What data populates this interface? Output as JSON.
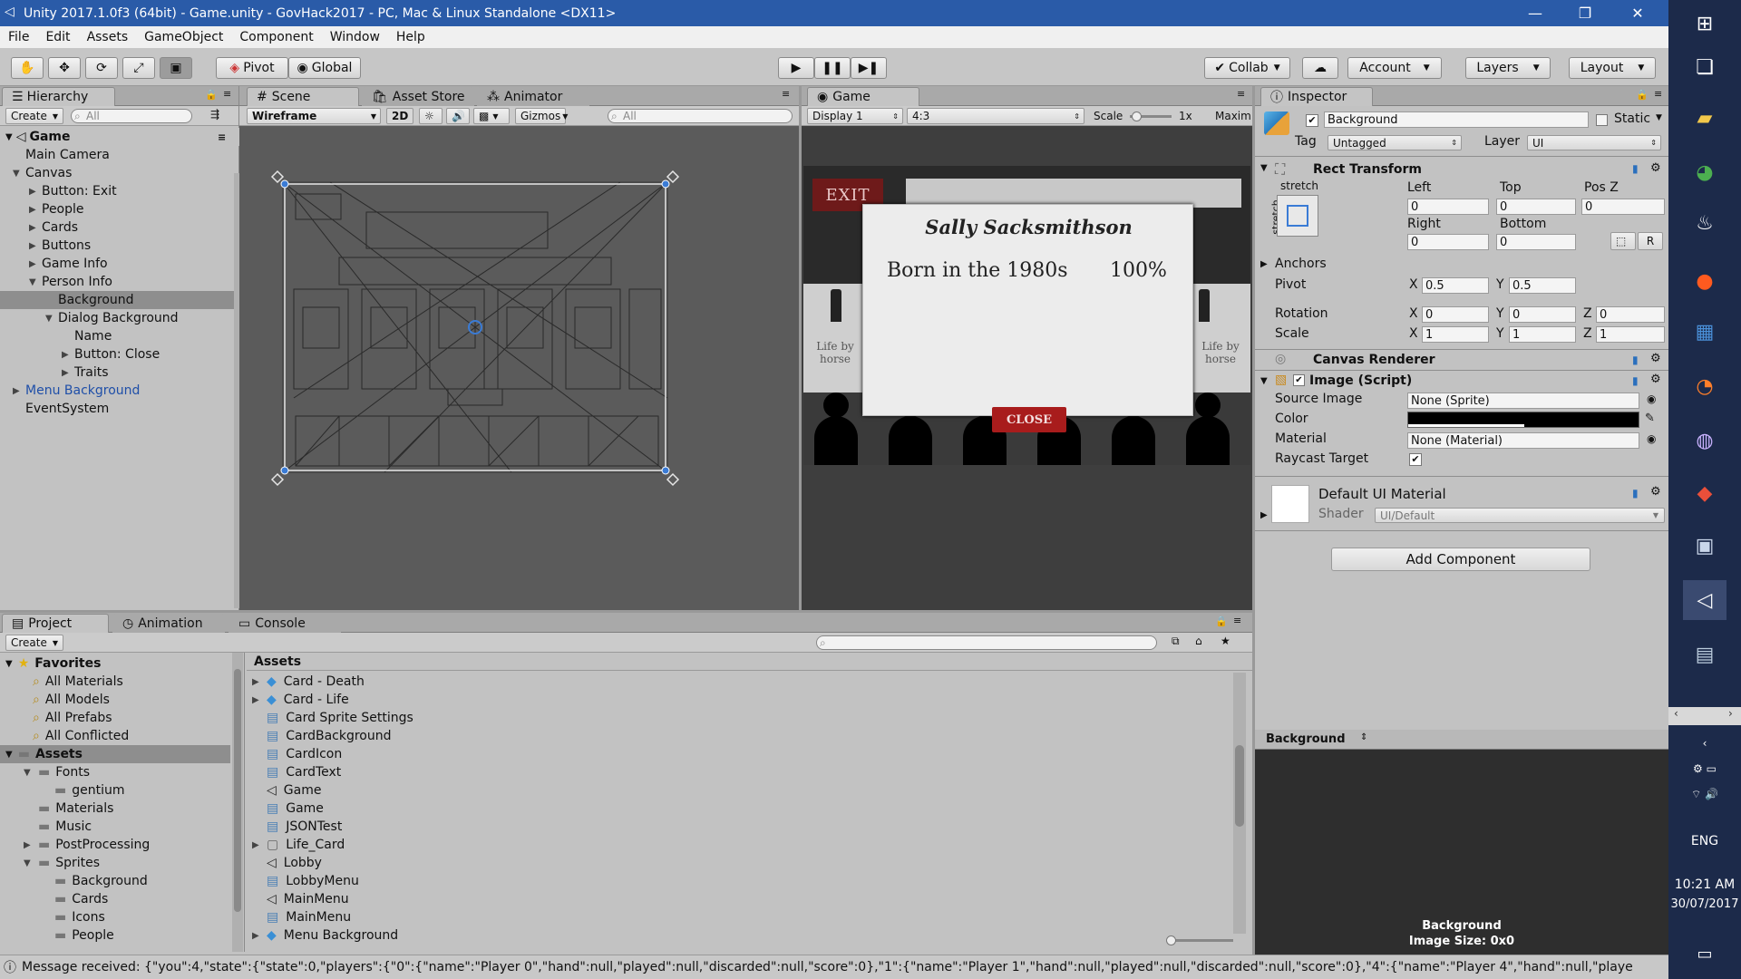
{
  "window": {
    "title": "Unity 2017.1.0f3 (64bit) - Game.unity - GovHack2017 - PC, Mac & Linux Standalone <DX11>"
  },
  "menu": [
    "File",
    "Edit",
    "Assets",
    "GameObject",
    "Component",
    "Window",
    "Help"
  ],
  "toolbar": {
    "pivot": "Pivot",
    "global": "Global",
    "collab": "Collab",
    "account": "Account",
    "layers": "Layers",
    "layout": "Layout"
  },
  "hierarchy": {
    "tab": "Hierarchy",
    "create": "Create",
    "search_placeholder": "All",
    "scene": "Game",
    "items": [
      {
        "label": "Main Camera",
        "indent": 1,
        "fold": ""
      },
      {
        "label": "Canvas",
        "indent": 1,
        "fold": "down"
      },
      {
        "label": "Button: Exit",
        "indent": 2,
        "fold": "right"
      },
      {
        "label": "People",
        "indent": 2,
        "fold": "right"
      },
      {
        "label": "Cards",
        "indent": 2,
        "fold": "right"
      },
      {
        "label": "Buttons",
        "indent": 2,
        "fold": "right"
      },
      {
        "label": "Game Info",
        "indent": 2,
        "fold": "right"
      },
      {
        "label": "Person Info",
        "indent": 2,
        "fold": "down"
      },
      {
        "label": "Background",
        "indent": 3,
        "fold": "",
        "selected": true
      },
      {
        "label": "Dialog Background",
        "indent": 3,
        "fold": "down"
      },
      {
        "label": "Name",
        "indent": 4,
        "fold": ""
      },
      {
        "label": "Button: Close",
        "indent": 4,
        "fold": "right"
      },
      {
        "label": "Traits",
        "indent": 4,
        "fold": "right"
      },
      {
        "label": "Menu Background",
        "indent": 1,
        "fold": "right",
        "blue": true
      },
      {
        "label": "EventSystem",
        "indent": 1,
        "fold": ""
      }
    ]
  },
  "scene": {
    "tabs": [
      "Scene",
      "Asset Store",
      "Animator"
    ],
    "mode": "Wireframe",
    "toggle_2d": "2D",
    "gizmos": "Gizmos",
    "search_placeholder": "All"
  },
  "game": {
    "tab": "Game",
    "display": "Display 1",
    "aspect": "4:3",
    "scale_label": "Scale",
    "scale_value": "1x",
    "maximize": "Maxim",
    "exit": "EXIT",
    "person_name": "Sally Sacksmithson",
    "trait": "Born in the 1980s",
    "percent": "100%",
    "close": "CLOSE",
    "card_left": "Life by horse",
    "card_right": "Life by horse"
  },
  "inspector": {
    "tab": "Inspector",
    "object_name": "Background",
    "static_label": "Static",
    "tag_label": "Tag",
    "tag_value": "Untagged",
    "layer_label": "Layer",
    "layer_value": "UI",
    "rect_transform": "Rect Transform",
    "stretch": "stretch",
    "left_label": "Left",
    "top_label": "Top",
    "posz_label": "Pos Z",
    "left": "0",
    "top": "0",
    "posz": "0",
    "right_label": "Right",
    "bottom_label": "Bottom",
    "right": "0",
    "bottom": "0",
    "r_button": "R",
    "anchors": "Anchors",
    "pivot_label": "Pivot",
    "pivot_x": "0.5",
    "pivot_y": "0.5",
    "rotation_label": "Rotation",
    "rot_x": "0",
    "rot_y": "0",
    "rot_z": "0",
    "scale_label": "Scale",
    "scale_x": "1",
    "scale_y": "1",
    "scale_z": "1",
    "x": "X",
    "y": "Y",
    "z": "Z",
    "canvas_renderer": "Canvas Renderer",
    "image_script": "Image (Script)",
    "source_image_label": "Source Image",
    "source_image": "None (Sprite)",
    "color_label": "Color",
    "material_label": "Material",
    "material": "None (Material)",
    "raycast_label": "Raycast Target",
    "default_material": "Default UI Material",
    "shader_label": "Shader",
    "shader": "UI/Default",
    "add_component": "Add Component",
    "preview_title": "Background",
    "preview_name": "Background",
    "preview_size": "Image Size: 0x0"
  },
  "project": {
    "tabs": [
      "Project",
      "Animation",
      "Console"
    ],
    "create": "Create",
    "favorites_label": "Favorites",
    "favorites": [
      "All Materials",
      "All Models",
      "All Prefabs",
      "All Conflicted"
    ],
    "assets_label": "Assets",
    "folders": [
      {
        "label": "Fonts",
        "indent": 1,
        "fold": "down"
      },
      {
        "label": "gentium",
        "indent": 2,
        "fold": ""
      },
      {
        "label": "Materials",
        "indent": 1,
        "fold": ""
      },
      {
        "label": "Music",
        "indent": 1,
        "fold": ""
      },
      {
        "label": "PostProcessing",
        "indent": 1,
        "fold": "right"
      },
      {
        "label": "Sprites",
        "indent": 1,
        "fold": "down"
      },
      {
        "label": "Background",
        "indent": 2,
        "fold": ""
      },
      {
        "label": "Cards",
        "indent": 2,
        "fold": ""
      },
      {
        "label": "Icons",
        "indent": 2,
        "fold": ""
      },
      {
        "label": "People",
        "indent": 2,
        "fold": ""
      }
    ],
    "breadcrumb": "Assets",
    "files": [
      {
        "label": "Card - Death",
        "icon": "prefab",
        "fold": true
      },
      {
        "label": "Card - Life",
        "icon": "prefab",
        "fold": true
      },
      {
        "label": "Card Sprite Settings",
        "icon": "script"
      },
      {
        "label": "CardBackground",
        "icon": "script"
      },
      {
        "label": "CardIcon",
        "icon": "script"
      },
      {
        "label": "CardText",
        "icon": "script"
      },
      {
        "label": "Game",
        "icon": "unity"
      },
      {
        "label": "Game",
        "icon": "script"
      },
      {
        "label": "JSONTest",
        "icon": "script"
      },
      {
        "label": "Life_Card",
        "icon": "box",
        "fold": true
      },
      {
        "label": "Lobby",
        "icon": "unity"
      },
      {
        "label": "LobbyMenu",
        "icon": "script"
      },
      {
        "label": "MainMenu",
        "icon": "unity"
      },
      {
        "label": "MainMenu",
        "icon": "script"
      },
      {
        "label": "Menu Background",
        "icon": "prefab",
        "fold": true
      }
    ]
  },
  "status": {
    "message": "Message received: {\"you\":4,\"state\":{\"state\":0,\"players\":{\"0\":{\"name\":\"Player 0\",\"hand\":null,\"played\":null,\"discarded\":null,\"score\":0},\"1\":{\"name\":\"Player 1\",\"hand\":null,\"played\":null,\"discarded\":null,\"score\":0},\"4\":{\"name\":\"Player 4\",\"hand\":null,\"playe"
  },
  "taskbar": {
    "language": "ENG",
    "time": "10:21 AM",
    "date": "30/07/2017"
  }
}
